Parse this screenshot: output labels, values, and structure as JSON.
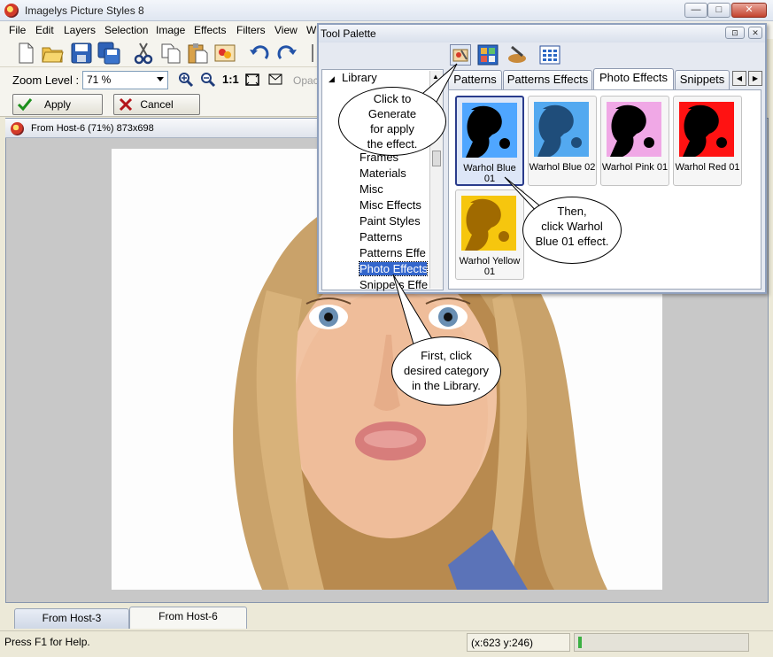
{
  "app": {
    "title": "Imagelys Picture Styles 8"
  },
  "window_buttons": {
    "minimize": "—",
    "maximize": "□",
    "close": "✕"
  },
  "menu": [
    "File",
    "Edit",
    "Layers",
    "Selection",
    "Image",
    "Effects",
    "Filters",
    "View",
    "W"
  ],
  "menu_underline": [
    "F",
    "E",
    "L",
    "S",
    "I",
    "c",
    "t",
    "V",
    "W"
  ],
  "toolbar": {
    "icons": [
      "new-document-icon",
      "open-folder-icon",
      "save-icon",
      "save-all-icon",
      "cut-icon",
      "copy-icon",
      "paste-icon",
      "effects-icon",
      "undo-icon",
      "redo-icon"
    ]
  },
  "zoom": {
    "label": "Zoom Level :",
    "value": "71 %",
    "one_to_one": "1:1",
    "opacity_label": "Opac"
  },
  "actions": {
    "apply": "Apply",
    "cancel": "Cancel"
  },
  "document": {
    "title": "From Host-6 (71%) 873x698"
  },
  "doc_tabs": [
    "From Host-3",
    "From Host-6"
  ],
  "status": {
    "help": "Press F1 for Help.",
    "coords": "(x:623 y:246)"
  },
  "palette": {
    "title": "Tool Palette",
    "library_header": "Library",
    "library_items": [
      "Frames",
      "Materials",
      "Misc",
      "Misc Effects",
      "Paint Styles",
      "Patterns",
      "Patterns Effe",
      "Photo Effects",
      "Snippets Effe"
    ],
    "tabs": [
      "Patterns",
      "Patterns Effects",
      "Photo Effects",
      "Snippets"
    ],
    "thumbs": [
      {
        "label": "Warhol Blue 01",
        "color": "#4fa6ff"
      },
      {
        "label": "Warhol Blue 02",
        "color": "#53a9f0"
      },
      {
        "label": "Warhol Pink 01",
        "color": "#f0a8e6"
      },
      {
        "label": "Warhol Red 01",
        "color": "#ff1212"
      },
      {
        "label": "Warhol Yellow 01",
        "color": "#f6c60e"
      }
    ]
  },
  "callouts": {
    "generate": "Click to Generate for apply the effect.",
    "generate_lines": [
      "Click  to",
      "Generate",
      "for apply",
      "the effect."
    ],
    "then_lines": [
      "Then,",
      "click Warhol",
      "Blue 01 effect."
    ],
    "first_lines": [
      "First, click",
      "desired category",
      "in the Library."
    ]
  }
}
